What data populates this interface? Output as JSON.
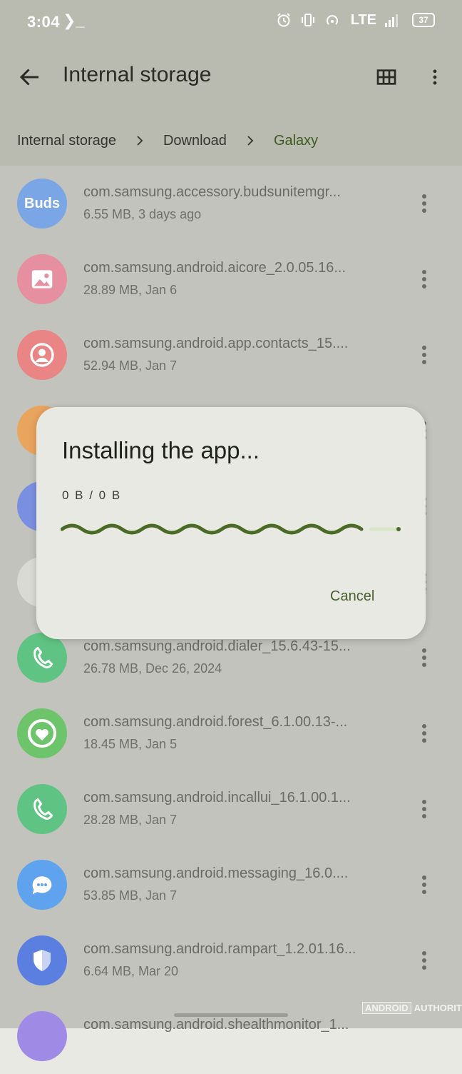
{
  "status_bar": {
    "time": "3:04",
    "terminal_glyph": "❯_",
    "network": "LTE",
    "battery": "37"
  },
  "app_bar": {
    "title": "Internal storage"
  },
  "breadcrumb": {
    "items": [
      "Internal storage",
      "Download",
      "Galaxy"
    ]
  },
  "files": [
    {
      "name": "com.samsung.accessory.budsunitemgr...",
      "meta": "6.55 MB, 3 days ago",
      "icon": "buds-icon",
      "icon_color": "#7aa6e6",
      "icon_text": "Buds"
    },
    {
      "name": "com.samsung.android.aicore_2.0.05.16...",
      "meta": "28.89 MB, Jan 6",
      "icon": "image-icon",
      "icon_color": "#e58fa0"
    },
    {
      "name": "com.samsung.android.app.contacts_15....",
      "meta": "52.94 MB, Jan 7",
      "icon": "contact-icon",
      "icon_color": "#e98585"
    },
    {
      "name": "com.samsung.android.dialer_15.6.43-15...",
      "meta": "26.78 MB, Dec 26, 2024",
      "icon": "phone-icon",
      "icon_color": "#5fc483"
    },
    {
      "name": "com.samsung.android.forest_6.1.00.13-...",
      "meta": "18.45 MB, Jan 5",
      "icon": "heart-icon",
      "icon_color": "#6dc46a"
    },
    {
      "name": "com.samsung.android.incallui_16.1.00.1...",
      "meta": "28.28 MB, Jan 7",
      "icon": "phone-icon",
      "icon_color": "#5fc483"
    },
    {
      "name": "com.samsung.android.messaging_16.0....",
      "meta": "53.85 MB, Jan 7",
      "icon": "chat-icon",
      "icon_color": "#5fa2ee"
    },
    {
      "name": "com.samsung.android.rampart_1.2.01.16...",
      "meta": "6.64 MB, Mar 20",
      "icon": "shield-icon",
      "icon_color": "#5b7fe0"
    },
    {
      "name": "com.samsung.android.shealthmonitor_1...",
      "meta": "",
      "icon": "health-icon",
      "icon_color": "#9f8be6"
    }
  ],
  "dialog": {
    "title": "Installing the app...",
    "progress_text": "0 B / 0 B",
    "cancel_label": "Cancel",
    "accent": "#4a6b25"
  },
  "watermark": {
    "part1": "ANDROID",
    "part2": "AUTHORITY"
  }
}
